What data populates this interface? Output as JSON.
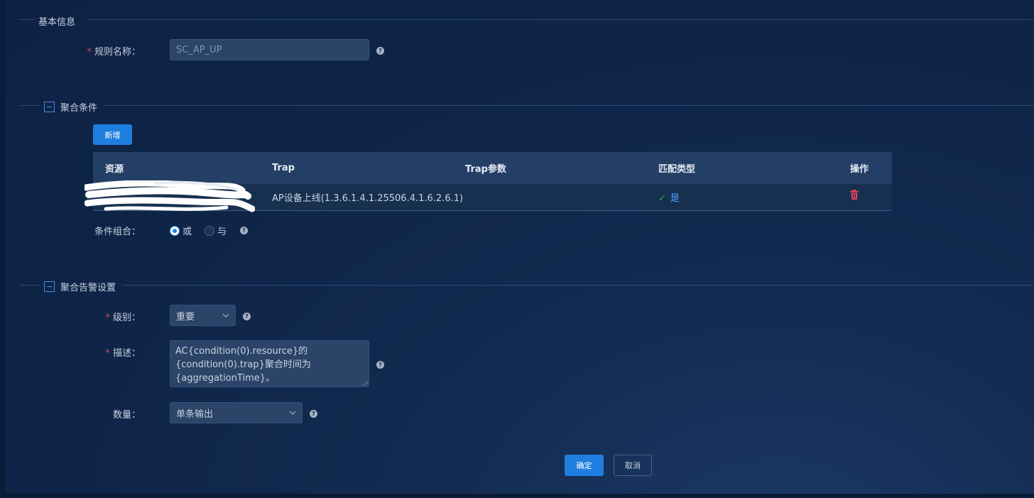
{
  "sections": {
    "basic": {
      "title": "基本信息"
    },
    "conditions": {
      "title": "聚合条件"
    },
    "alarm": {
      "title": "聚合告警设置"
    }
  },
  "basic": {
    "rule_name_label": "规则名称：",
    "rule_name_value": "SC_AP_UP"
  },
  "conditions": {
    "add_button": "新增",
    "table": {
      "headers": [
        "资源",
        "Trap",
        "Trap参数",
        "匹配类型",
        "操作"
      ],
      "rows": [
        {
          "resource": "",
          "trap": "AP设备上线(1.3.6.1.4.1.25506.4.1.6.2.6.1)",
          "trap_params": "",
          "match": "是"
        }
      ]
    },
    "combo_label": "条件组合：",
    "combo_options": [
      "或",
      "与"
    ],
    "combo_selected": "或"
  },
  "alarm": {
    "level_label": "级别：",
    "level_value": "重要",
    "desc_label": "描述：",
    "desc_lines": [
      "AC{condition(0).resource}的",
      "{condition(0).trap}聚合时间为",
      "{aggregationTime}。"
    ],
    "count_label": "数量：",
    "count_value": "单条输出"
  },
  "footer": {
    "confirm": "确定",
    "cancel": "取消"
  },
  "required_mark": "*",
  "help_glyph": "?"
}
